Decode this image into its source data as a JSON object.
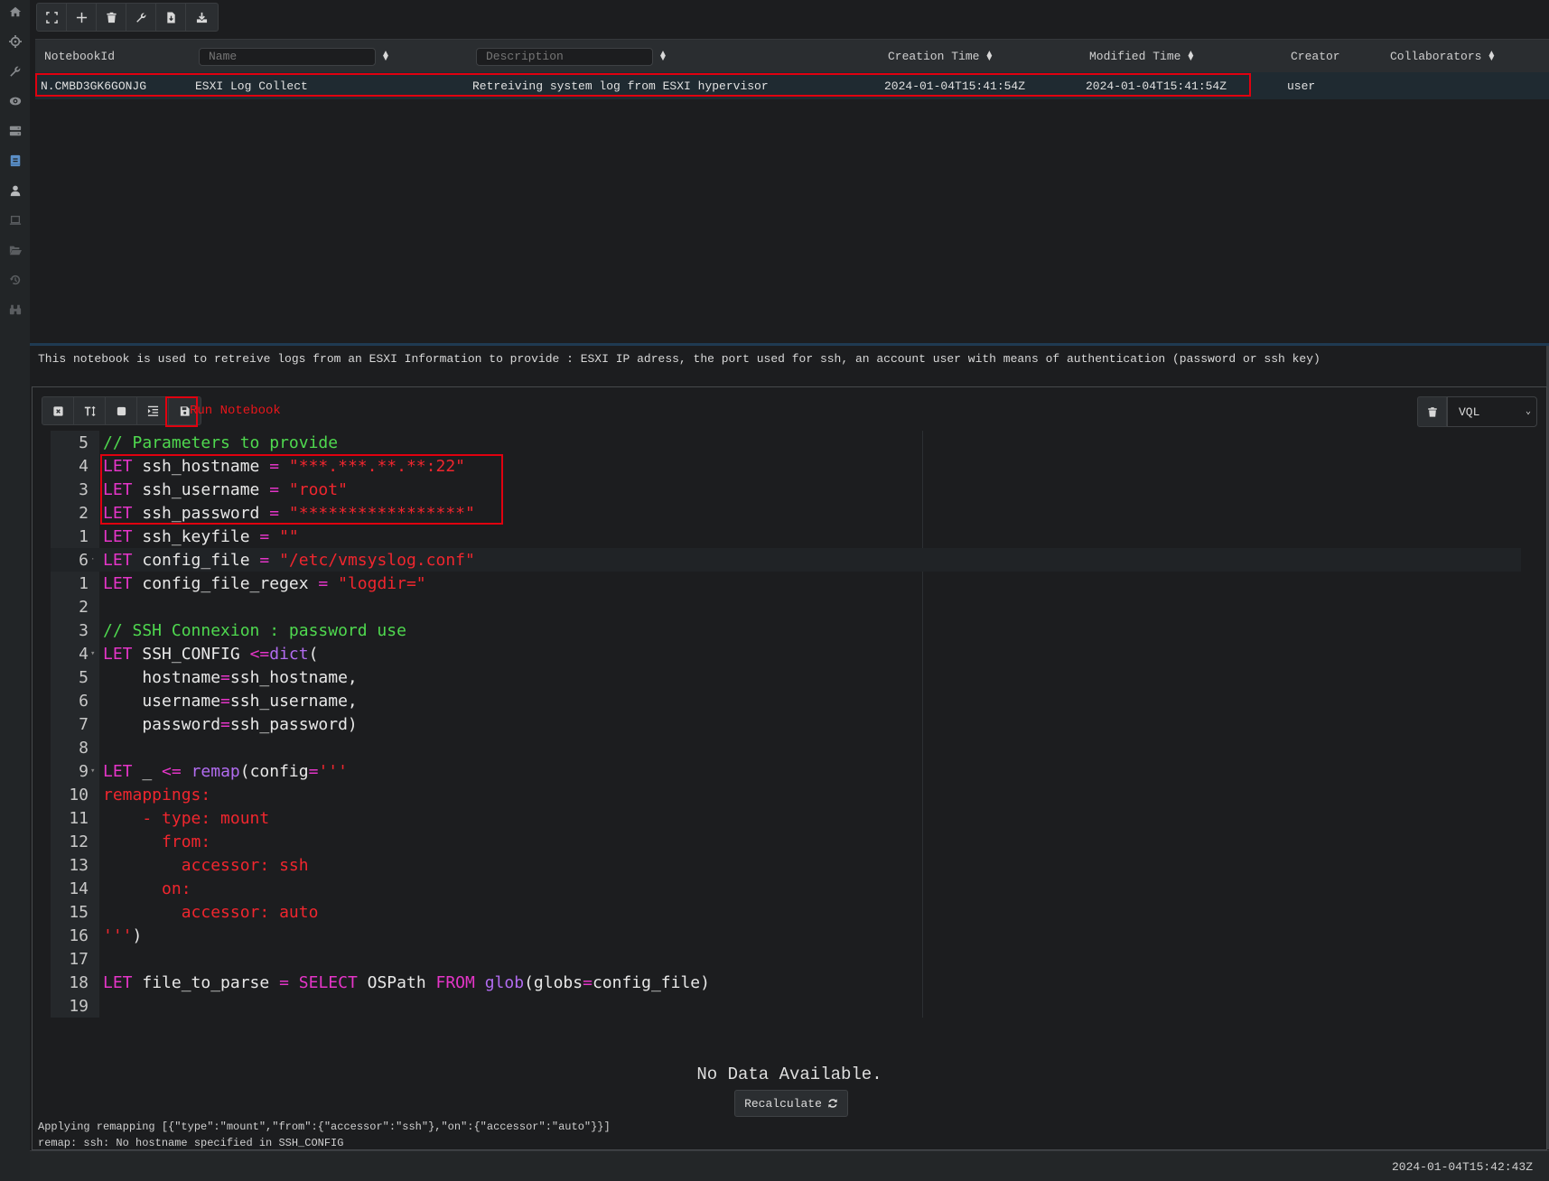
{
  "sidebar": {
    "items": [
      {
        "icon": "home-icon",
        "active": false
      },
      {
        "icon": "crosshairs-icon",
        "active": false
      },
      {
        "icon": "wrench-icon",
        "active": false
      },
      {
        "icon": "eye-icon",
        "active": false
      },
      {
        "icon": "server-icon",
        "active": false
      },
      {
        "icon": "notebook-icon",
        "active": true
      },
      {
        "icon": "user-icon",
        "active": false
      },
      {
        "icon": "laptop-icon",
        "active": false
      },
      {
        "icon": "folder-open-icon",
        "active": false
      },
      {
        "icon": "history-icon",
        "active": false
      },
      {
        "icon": "binoculars-icon",
        "active": false
      }
    ]
  },
  "toolbar": {
    "buttons": [
      "fullscreen-icon",
      "plus-icon",
      "trash-icon",
      "wrench-icon",
      "file-download-icon",
      "download-icon"
    ]
  },
  "notebooks_table": {
    "columns": {
      "id": "NotebookId",
      "name_placeholder": "Name",
      "description_placeholder": "Description",
      "creation_time": "Creation Time",
      "modified_time": "Modified Time",
      "creator": "Creator",
      "collaborators": "Collaborators"
    },
    "rows": [
      {
        "id": "N.CMBD3GK6GONJG",
        "name": "ESXI Log Collect",
        "description": "Retreiving system log from ESXI hypervisor",
        "creation_time": "2024-01-04T15:41:54Z",
        "modified_time": "2024-01-04T15:41:54Z",
        "creator": "user",
        "collaborators": ""
      }
    ]
  },
  "notebook_description": "This notebook is used to retreive logs from an ESXI Information to provide : ESXI IP adress, the port used for ssh, an account user with means of authentication (password or ssh key)",
  "cell": {
    "toolbar_buttons": [
      "close-cell-icon",
      "text-height-icon",
      "stop-icon",
      "indent-icon",
      "save-icon"
    ],
    "run_label": "Run Notebook",
    "language": "VQL",
    "code_lines": [
      {
        "ln": "5",
        "fold": "",
        "tokens": [
          [
            "cm",
            "// Parameters to provide"
          ]
        ]
      },
      {
        "ln": "4",
        "fold": "",
        "tokens": [
          [
            "kw",
            "LET"
          ],
          [
            "",
            " ssh_hostname "
          ],
          [
            "op",
            "="
          ],
          [
            "",
            " "
          ],
          [
            "str",
            "\"***.***.**.**:22\""
          ]
        ]
      },
      {
        "ln": "3",
        "fold": "",
        "tokens": [
          [
            "kw",
            "LET"
          ],
          [
            "",
            " ssh_username "
          ],
          [
            "op",
            "="
          ],
          [
            "",
            " "
          ],
          [
            "str",
            "\"root\""
          ]
        ]
      },
      {
        "ln": "2",
        "fold": "",
        "tokens": [
          [
            "kw",
            "LET"
          ],
          [
            "",
            " ssh_password "
          ],
          [
            "op",
            "="
          ],
          [
            "",
            " "
          ],
          [
            "str",
            "\"*****************\""
          ]
        ]
      },
      {
        "ln": "1",
        "fold": "",
        "tokens": [
          [
            "kw",
            "LET"
          ],
          [
            "",
            " ssh_keyfile "
          ],
          [
            "op",
            "="
          ],
          [
            "",
            " "
          ],
          [
            "str",
            "\"\""
          ]
        ]
      },
      {
        "ln": "6",
        "fold": "·",
        "active": true,
        "tokens": [
          [
            "kw",
            "LET"
          ],
          [
            "",
            " config_file "
          ],
          [
            "op",
            "="
          ],
          [
            "",
            " "
          ],
          [
            "str",
            "\"/etc/vmsyslog.conf\""
          ]
        ]
      },
      {
        "ln": "1",
        "fold": "",
        "tokens": [
          [
            "kw",
            "LET"
          ],
          [
            "",
            " config_file_regex "
          ],
          [
            "op",
            "="
          ],
          [
            "",
            " "
          ],
          [
            "str",
            "\"logdir=\""
          ]
        ]
      },
      {
        "ln": "2",
        "fold": "",
        "tokens": []
      },
      {
        "ln": "3",
        "fold": "",
        "tokens": [
          [
            "cm",
            "// SSH Connexion : password use"
          ]
        ]
      },
      {
        "ln": "4",
        "fold": "▾",
        "tokens": [
          [
            "kw",
            "LET"
          ],
          [
            "",
            " SSH_CONFIG "
          ],
          [
            "op",
            "<="
          ],
          [
            "fn",
            "dict"
          ],
          [
            "",
            "("
          ]
        ]
      },
      {
        "ln": "5",
        "fold": "",
        "tokens": [
          [
            "",
            "    hostname"
          ],
          [
            "op",
            "="
          ],
          [
            "",
            "ssh_hostname,"
          ]
        ]
      },
      {
        "ln": "6",
        "fold": "",
        "tokens": [
          [
            "",
            "    username"
          ],
          [
            "op",
            "="
          ],
          [
            "",
            "ssh_username,"
          ]
        ]
      },
      {
        "ln": "7",
        "fold": "",
        "tokens": [
          [
            "",
            "    password"
          ],
          [
            "op",
            "="
          ],
          [
            "",
            "ssh_password)"
          ]
        ]
      },
      {
        "ln": "8",
        "fold": "",
        "tokens": []
      },
      {
        "ln": "9",
        "fold": "▾",
        "tokens": [
          [
            "kw",
            "LET"
          ],
          [
            "",
            " _ "
          ],
          [
            "op",
            "<="
          ],
          [
            "",
            " "
          ],
          [
            "fn",
            "remap"
          ],
          [
            "",
            "(config"
          ],
          [
            "op",
            "="
          ],
          [
            "str",
            "'''"
          ]
        ]
      },
      {
        "ln": "10",
        "fold": "",
        "tokens": [
          [
            "str",
            "remappings:"
          ]
        ]
      },
      {
        "ln": "11",
        "fold": "",
        "tokens": [
          [
            "str",
            "    - type: mount"
          ]
        ]
      },
      {
        "ln": "12",
        "fold": "",
        "tokens": [
          [
            "str",
            "      from:"
          ]
        ]
      },
      {
        "ln": "13",
        "fold": "",
        "tokens": [
          [
            "str",
            "        accessor: ssh"
          ]
        ]
      },
      {
        "ln": "14",
        "fold": "",
        "tokens": [
          [
            "str",
            "      on:"
          ]
        ]
      },
      {
        "ln": "15",
        "fold": "",
        "tokens": [
          [
            "str",
            "        accessor: auto"
          ]
        ]
      },
      {
        "ln": "16",
        "fold": "",
        "tokens": [
          [
            "str",
            "'''"
          ],
          [
            "",
            ")"
          ]
        ]
      },
      {
        "ln": "17",
        "fold": "",
        "tokens": []
      },
      {
        "ln": "18",
        "fold": "",
        "tokens": [
          [
            "kw",
            "LET"
          ],
          [
            "",
            " file_to_parse "
          ],
          [
            "op",
            "="
          ],
          [
            "",
            " "
          ],
          [
            "kw",
            "SELECT"
          ],
          [
            "",
            " OSPath "
          ],
          [
            "kw",
            "FROM"
          ],
          [
            "",
            " "
          ],
          [
            "fn",
            "glob"
          ],
          [
            "",
            "(globs"
          ],
          [
            "op",
            "="
          ],
          [
            "",
            "config_file)"
          ]
        ]
      },
      {
        "ln": "19",
        "fold": "",
        "tokens": []
      }
    ],
    "no_data": "No Data Available.",
    "recalculate_label": "Recalculate",
    "logs": [
      "Applying remapping [{\"type\":\"mount\",\"from\":{\"accessor\":\"ssh\"},\"on\":{\"accessor\":\"auto\"}}]",
      "remap: ssh: No hostname specified in SSH_CONFIG"
    ]
  },
  "status_bar": {
    "time": "2024-01-04T15:42:43Z"
  },
  "colors": {
    "accent_red": "#e0000f",
    "keyword": "#e535c8",
    "function": "#b26cf0",
    "string": "#f0262e",
    "comment": "#4fd94f",
    "active_sidebar": "#5b8fc7"
  }
}
